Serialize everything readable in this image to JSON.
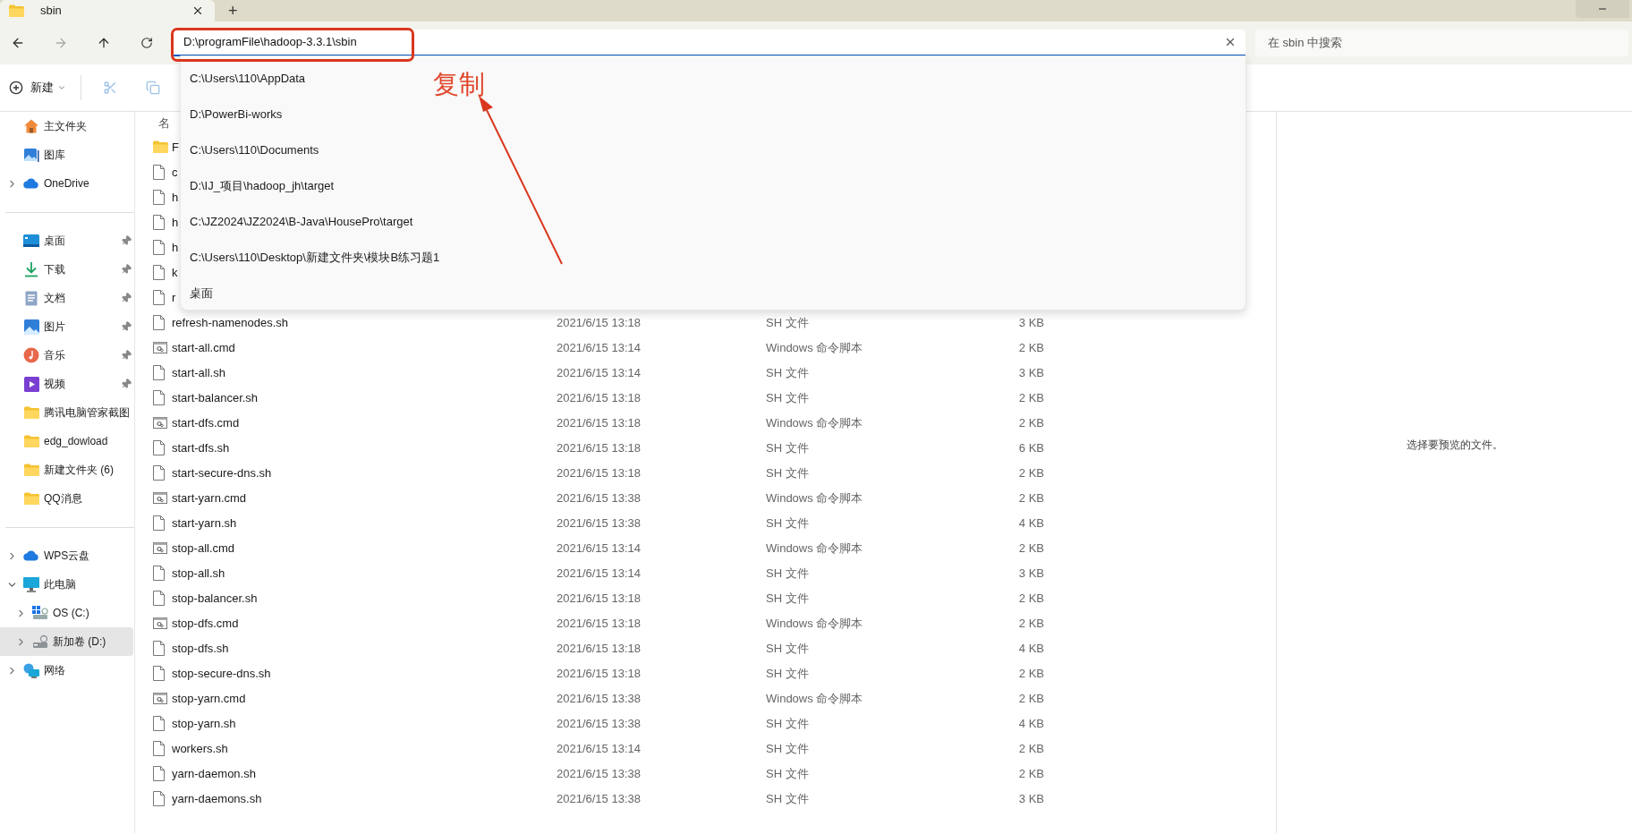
{
  "tab": {
    "title": "sbin",
    "new_tab": "+"
  },
  "address": {
    "value": "D:\\programFile\\hadoop-3.3.1\\sbin"
  },
  "search": {
    "placeholder": "在 sbin 中搜索"
  },
  "toolbar": {
    "new_label": "新建",
    "cut_disabled": true,
    "copy_disabled": true
  },
  "suggestions": [
    {
      "text": "C:\\Users\\110\\AppData"
    },
    {
      "text": "D:\\PowerBi-works"
    },
    {
      "text": "C:\\Users\\110\\Documents"
    },
    {
      "text": "D:\\IJ_项目\\hadoop_jh\\target"
    },
    {
      "text": "C:\\JZ2024\\JZ2024\\B-Java\\HousePro\\target"
    },
    {
      "text": "C:\\Users\\110\\Desktop\\新建文件夹\\模块B练习题1"
    },
    {
      "text": "桌面"
    }
  ],
  "annotation": {
    "label": "复制"
  },
  "sidebar": {
    "sections": [
      {
        "items": [
          {
            "label": "主文件夹",
            "kind": "home",
            "selected": false
          },
          {
            "label": "图库",
            "kind": "gallery",
            "selected": false
          },
          {
            "label": "OneDrive",
            "kind": "cloud",
            "selected": false,
            "expanded": false
          }
        ]
      },
      {
        "items": [
          {
            "label": "桌面",
            "kind": "desktop",
            "selected": false,
            "pinned": true
          },
          {
            "label": "下载",
            "kind": "download",
            "selected": false,
            "pinned": true
          },
          {
            "label": "文档",
            "kind": "document",
            "selected": false,
            "pinned": true
          },
          {
            "label": "图片",
            "kind": "picture",
            "selected": false,
            "pinned": true
          },
          {
            "label": "音乐",
            "kind": "music",
            "selected": false,
            "pinned": true
          },
          {
            "label": "视频",
            "kind": "video",
            "selected": false,
            "pinned": true
          },
          {
            "label": "腾讯电脑管家截图",
            "kind": "folder",
            "selected": false,
            "pinned": false
          },
          {
            "label": "edg_dowload",
            "kind": "folder",
            "selected": false,
            "pinned": false
          },
          {
            "label": "新建文件夹 (6)",
            "kind": "folder",
            "selected": false,
            "pinned": false
          },
          {
            "label": "QQ消息",
            "kind": "folder",
            "selected": false,
            "pinned": false
          }
        ]
      },
      {
        "items": [
          {
            "label": "WPS云盘",
            "kind": "cloud",
            "selected": false,
            "expanded": false
          },
          {
            "label": "此电脑",
            "kind": "pc",
            "selected": false,
            "expanded": true,
            "children": [
              {
                "label": "OS (C:)",
                "kind": "windows-drive",
                "selected": false,
                "expanded": false
              },
              {
                "label": "新加卷 (D:)",
                "kind": "drive",
                "selected": true,
                "expanded": false
              }
            ]
          },
          {
            "label": "网络",
            "kind": "network",
            "selected": false,
            "expanded": false
          }
        ]
      }
    ]
  },
  "file_list": {
    "columns": [
      "名"
    ],
    "rows": [
      {
        "name": "F",
        "kind": "folder"
      },
      {
        "name": "c",
        "kind": "sh"
      },
      {
        "name": "h",
        "kind": "sh"
      },
      {
        "name": "h",
        "kind": "sh"
      },
      {
        "name": "h",
        "kind": "sh"
      },
      {
        "name": "k",
        "kind": "sh"
      },
      {
        "name": "r",
        "kind": "sh"
      },
      {
        "name": "refresh-namenodes.sh",
        "kind": "sh",
        "date": "2021/6/15 13:18",
        "type": "SH 文件",
        "size": "3 KB"
      },
      {
        "name": "start-all.cmd",
        "kind": "cmd",
        "date": "2021/6/15 13:14",
        "type": "Windows 命令脚本",
        "size": "2 KB"
      },
      {
        "name": "start-all.sh",
        "kind": "sh",
        "date": "2021/6/15 13:14",
        "type": "SH 文件",
        "size": "3 KB"
      },
      {
        "name": "start-balancer.sh",
        "kind": "sh",
        "date": "2021/6/15 13:18",
        "type": "SH 文件",
        "size": "2 KB"
      },
      {
        "name": "start-dfs.cmd",
        "kind": "cmd",
        "date": "2021/6/15 13:18",
        "type": "Windows 命令脚本",
        "size": "2 KB"
      },
      {
        "name": "start-dfs.sh",
        "kind": "sh",
        "date": "2021/6/15 13:18",
        "type": "SH 文件",
        "size": "6 KB"
      },
      {
        "name": "start-secure-dns.sh",
        "kind": "sh",
        "date": "2021/6/15 13:18",
        "type": "SH 文件",
        "size": "2 KB"
      },
      {
        "name": "start-yarn.cmd",
        "kind": "cmd",
        "date": "2021/6/15 13:38",
        "type": "Windows 命令脚本",
        "size": "2 KB"
      },
      {
        "name": "start-yarn.sh",
        "kind": "sh",
        "date": "2021/6/15 13:38",
        "type": "SH 文件",
        "size": "4 KB"
      },
      {
        "name": "stop-all.cmd",
        "kind": "cmd",
        "date": "2021/6/15 13:14",
        "type": "Windows 命令脚本",
        "size": "2 KB"
      },
      {
        "name": "stop-all.sh",
        "kind": "sh",
        "date": "2021/6/15 13:14",
        "type": "SH 文件",
        "size": "3 KB"
      },
      {
        "name": "stop-balancer.sh",
        "kind": "sh",
        "date": "2021/6/15 13:18",
        "type": "SH 文件",
        "size": "2 KB"
      },
      {
        "name": "stop-dfs.cmd",
        "kind": "cmd",
        "date": "2021/6/15 13:18",
        "type": "Windows 命令脚本",
        "size": "2 KB"
      },
      {
        "name": "stop-dfs.sh",
        "kind": "sh",
        "date": "2021/6/15 13:18",
        "type": "SH 文件",
        "size": "4 KB"
      },
      {
        "name": "stop-secure-dns.sh",
        "kind": "sh",
        "date": "2021/6/15 13:18",
        "type": "SH 文件",
        "size": "2 KB"
      },
      {
        "name": "stop-yarn.cmd",
        "kind": "cmd",
        "date": "2021/6/15 13:38",
        "type": "Windows 命令脚本",
        "size": "2 KB"
      },
      {
        "name": "stop-yarn.sh",
        "kind": "sh",
        "date": "2021/6/15 13:38",
        "type": "SH 文件",
        "size": "4 KB"
      },
      {
        "name": "workers.sh",
        "kind": "sh",
        "date": "2021/6/15 13:14",
        "type": "SH 文件",
        "size": "2 KB"
      },
      {
        "name": "yarn-daemon.sh",
        "kind": "sh",
        "date": "2021/6/15 13:38",
        "type": "SH 文件",
        "size": "2 KB"
      },
      {
        "name": "yarn-daemons.sh",
        "kind": "sh",
        "date": "2021/6/15 13:38",
        "type": "SH 文件",
        "size": "3 KB"
      }
    ]
  },
  "preview": {
    "message": "选择要预览的文件。"
  }
}
